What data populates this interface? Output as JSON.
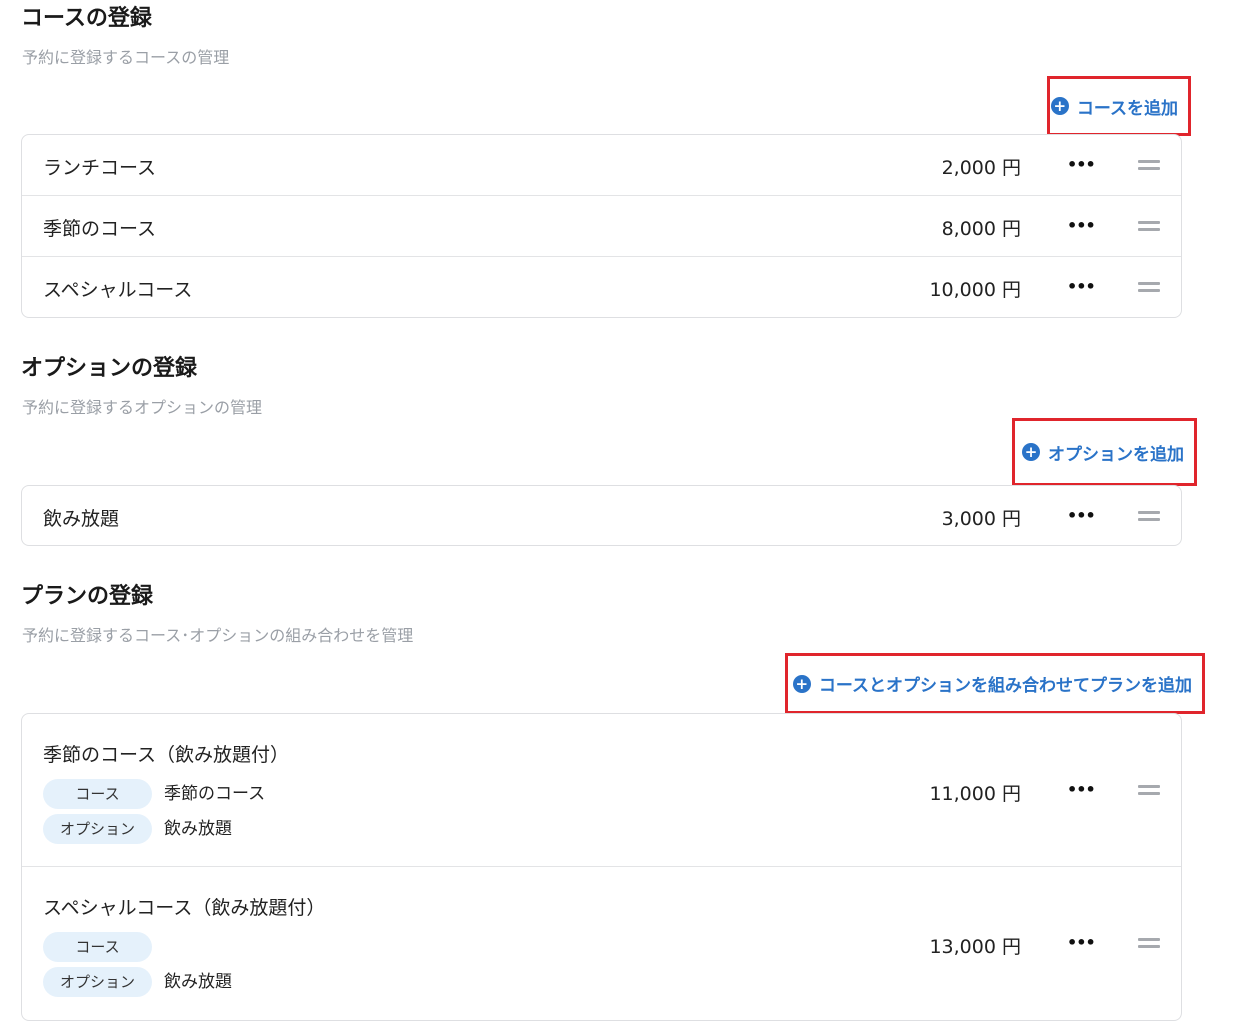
{
  "courses": {
    "title": "コースの登録",
    "subtitle": "予約に登録するコースの管理",
    "add_label": "コースを追加",
    "items": [
      {
        "name": "ランチコース",
        "price": "2,000 円"
      },
      {
        "name": "季節のコース",
        "price": "8,000 円"
      },
      {
        "name": "スペシャルコース",
        "price": "10,000 円"
      }
    ]
  },
  "options": {
    "title": "オプションの登録",
    "subtitle": "予約に登録するオプションの管理",
    "add_label": "オプションを追加",
    "items": [
      {
        "name": "飲み放題",
        "price": "3,000 円"
      }
    ]
  },
  "plans": {
    "title": "プランの登録",
    "subtitle": "予約に登録するコース･オプションの組み合わせを管理",
    "add_label": "コースとオプションを組み合わせてプランを追加",
    "items": [
      {
        "name": "季節のコース（飲み放題付）",
        "course_tag": "コース",
        "course_value": "季節のコース",
        "option_tag": "オプション",
        "option_value": "飲み放題",
        "price": "11,000 円"
      },
      {
        "name": "スペシャルコース（飲み放題付）",
        "course_tag": "コース",
        "course_value": "",
        "option_tag": "オプション",
        "option_value": "飲み放題",
        "price": "13,000 円"
      }
    ]
  },
  "icons": {
    "plus": "plus-circle-icon",
    "more": "more-horizontal-icon",
    "drag": "drag-handle-icon"
  },
  "colors": {
    "accent": "#2a73c8",
    "highlight_border": "#e0252c",
    "tag_bg": "#e5f1fb"
  }
}
